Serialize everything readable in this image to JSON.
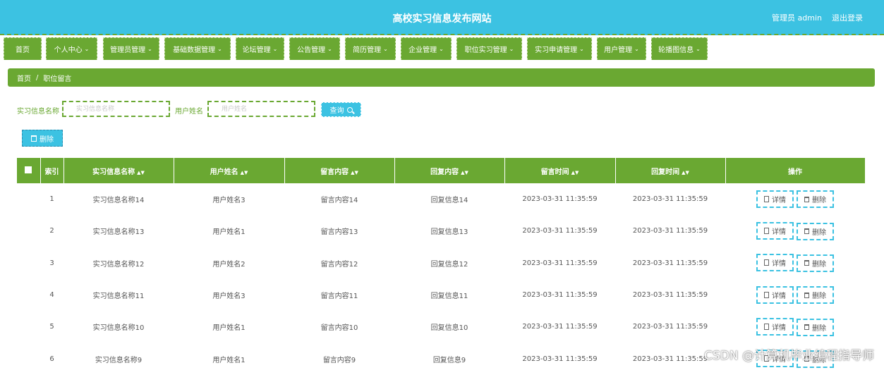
{
  "header": {
    "site_title": "高校实习信息发布网站",
    "admin_label": "管理员 admin",
    "logout_label": "退出登录"
  },
  "nav": {
    "items": [
      {
        "label": "首页",
        "chev": false
      },
      {
        "label": "个人中心",
        "chev": true
      },
      {
        "label": "管理员管理",
        "chev": true
      },
      {
        "label": "基础数据管理",
        "chev": true
      },
      {
        "label": "论坛管理",
        "chev": true
      },
      {
        "label": "公告管理",
        "chev": true
      },
      {
        "label": "简历管理",
        "chev": true
      },
      {
        "label": "企业管理",
        "chev": true
      },
      {
        "label": "职位实习管理",
        "chev": true
      },
      {
        "label": "实习申请管理",
        "chev": true
      },
      {
        "label": "用户管理",
        "chev": true
      },
      {
        "label": "轮播图信息",
        "chev": true
      }
    ]
  },
  "breadcrumb": {
    "home": "首页",
    "separator": "/",
    "current": "职位留言"
  },
  "search": {
    "field1_label": "实习信息名称",
    "field1_placeholder": "实习信息名称",
    "field2_label": "用户姓名",
    "field2_placeholder": "用户姓名",
    "query_label": "查询"
  },
  "toolbar": {
    "delete_label": "删除"
  },
  "table": {
    "headers": [
      "索引",
      "实习信息名称",
      "用户姓名",
      "留言内容",
      "回复内容",
      "留言时间",
      "回复时间",
      "操作"
    ],
    "detail_label": "详情",
    "delete_label": "删除",
    "rows": [
      [
        "1",
        "实习信息名称14",
        "用户姓名3",
        "留言内容14",
        "回复信息14",
        "2023-03-31 11:35:59",
        "2023-03-31 11:35:59"
      ],
      [
        "2",
        "实习信息名称13",
        "用户姓名1",
        "留言内容13",
        "回复信息13",
        "2023-03-31 11:35:59",
        "2023-03-31 11:35:59"
      ],
      [
        "3",
        "实习信息名称12",
        "用户姓名2",
        "留言内容12",
        "回复信息12",
        "2023-03-31 11:35:59",
        "2023-03-31 11:35:59"
      ],
      [
        "4",
        "实习信息名称11",
        "用户姓名3",
        "留言内容11",
        "回复信息11",
        "2023-03-31 11:35:59",
        "2023-03-31 11:35:59"
      ],
      [
        "5",
        "实习信息名称10",
        "用户姓名1",
        "留言内容10",
        "回复信息10",
        "2023-03-31 11:35:59",
        "2023-03-31 11:35:59"
      ],
      [
        "6",
        "实习信息名称9",
        "用户姓名1",
        "留言内容9",
        "回复信息9",
        "2023-03-31 11:35:59",
        "2023-03-31 11:35:59"
      ]
    ]
  },
  "watermark": "CSDN @计算机毕业编程指导师",
  "colors": {
    "header_bg": "#3cc2e2",
    "primary_green": "#6aa832",
    "button_blue": "#3cc2e2"
  }
}
